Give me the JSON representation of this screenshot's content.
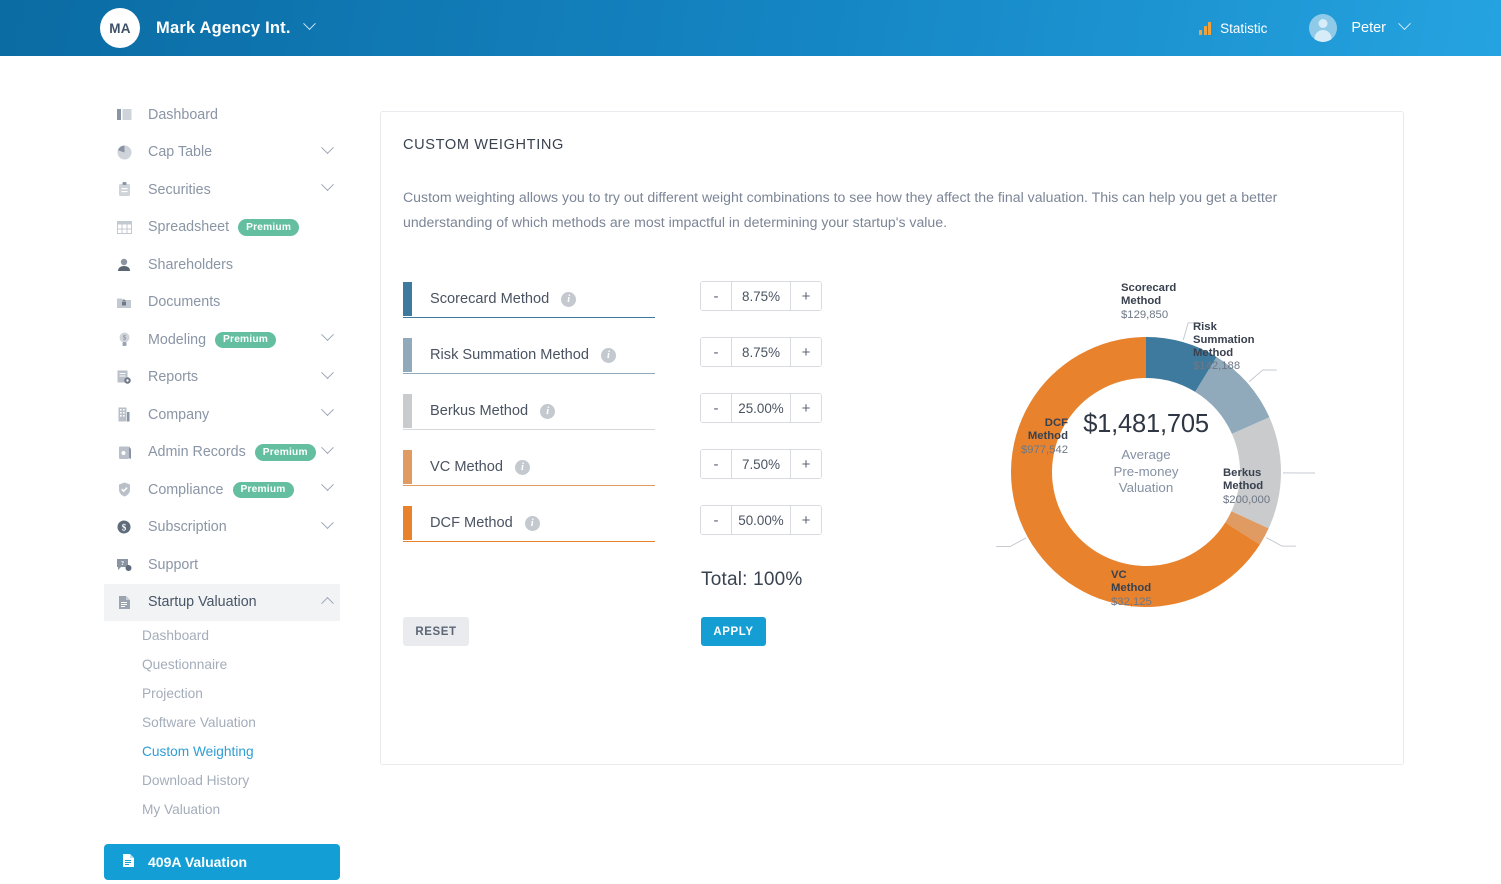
{
  "header": {
    "avatar_initials": "MA",
    "company": "Mark Agency Int.",
    "statistic_label": "Statistic",
    "user_name": "Peter",
    "icons": {
      "statistic": "bar-chart-icon",
      "company_chevron": "chevron-down-icon",
      "user_chevron": "chevron-down-icon"
    }
  },
  "sidebar": {
    "items": [
      {
        "label": "Dashboard",
        "icon": "dashboard-icon",
        "premium": null,
        "expandable": false
      },
      {
        "label": "Cap Table",
        "icon": "pie-chart-icon",
        "premium": null,
        "expandable": true
      },
      {
        "label": "Securities",
        "icon": "clipboard-icon",
        "premium": null,
        "expandable": true
      },
      {
        "label": "Spreadsheet",
        "icon": "table-icon",
        "premium": "Premium",
        "expandable": false
      },
      {
        "label": "Shareholders",
        "icon": "person-icon",
        "premium": null,
        "expandable": false
      },
      {
        "label": "Documents",
        "icon": "folder-lock-icon",
        "premium": null,
        "expandable": false
      },
      {
        "label": "Modeling",
        "icon": "lightbulb-icon",
        "premium": "Premium",
        "expandable": true
      },
      {
        "label": "Reports",
        "icon": "report-gear-icon",
        "premium": null,
        "expandable": true
      },
      {
        "label": "Company",
        "icon": "building-icon",
        "premium": null,
        "expandable": true
      },
      {
        "label": "Admin Records",
        "icon": "archive-icon",
        "premium": "Premium",
        "expandable": true
      },
      {
        "label": "Compliance",
        "icon": "shield-check-icon",
        "premium": "Premium",
        "expandable": true
      },
      {
        "label": "Subscription",
        "icon": "dollar-coin-icon",
        "premium": null,
        "expandable": true
      },
      {
        "label": "Support",
        "icon": "help-chat-icon",
        "premium": null,
        "expandable": false
      }
    ],
    "active_group": {
      "label": "Startup Valuation",
      "icon": "document-icon",
      "expandable": true,
      "expanded": true
    },
    "sub_items": [
      {
        "label": "Dashboard",
        "current": false
      },
      {
        "label": "Questionnaire",
        "current": false
      },
      {
        "label": "Projection",
        "current": false
      },
      {
        "label": "Software Valuation",
        "current": false
      },
      {
        "label": "Custom Weighting",
        "current": true
      },
      {
        "label": "Download History",
        "current": false
      },
      {
        "label": "My Valuation",
        "current": false
      }
    ],
    "cta": {
      "label": "409A Valuation",
      "icon": "document-icon"
    }
  },
  "main": {
    "title": "CUSTOM WEIGHTING",
    "description": "Custom weighting allows you to try out different weight combinations to see how they affect the final valuation. This can help you get a better understanding of which methods are most impactful in determining your startup's value.",
    "methods": [
      {
        "name": "Scorecard Method",
        "weight": "8.75%",
        "color": "#3e7a9e"
      },
      {
        "name": "Risk Summation Method",
        "weight": "8.75%",
        "color": "#90aabc"
      },
      {
        "name": "Berkus Method",
        "weight": "25.00%",
        "color": "#c9cbcc"
      },
      {
        "name": "VC Method",
        "weight": "7.50%",
        "color": "#e09b63"
      },
      {
        "name": "DCF Method",
        "weight": "50.00%",
        "color": "#e8822c"
      }
    ],
    "stepper": {
      "minus": "-",
      "plus": "+"
    },
    "total_label": "Total: 100%",
    "reset_label": "RESET",
    "apply_label": "APPLY"
  },
  "chart_data": {
    "type": "pie",
    "title": "",
    "center_value": "$1,481,705",
    "center_subtitle": "Average\nPre-money\nValuation",
    "center_subtitle_lines": [
      "Average",
      "Pre-money",
      "Valuation"
    ],
    "legend_position": "callout-labels",
    "categories": [
      "Scorecard Method",
      "Risk Summation Method",
      "Berkus Method",
      "VC Method",
      "DCF Method"
    ],
    "values": [
      129850,
      142188,
      200000,
      32125,
      977542
    ],
    "value_labels": [
      "$129,850",
      "$142,188",
      "$200,000",
      "$32,125",
      "$977,542"
    ],
    "percentages": [
      8.76,
      9.6,
      13.5,
      2.17,
      65.97
    ],
    "colors": [
      "#3e7a9e",
      "#90aabc",
      "#c9cbcc",
      "#e09b63",
      "#e8822c"
    ],
    "labels": [
      {
        "name_lines": [
          "Scorecard",
          "Method"
        ],
        "amount": "$129,850"
      },
      {
        "name_lines": [
          "Risk",
          "Summation",
          "Method"
        ],
        "amount": "$142,188"
      },
      {
        "name_lines": [
          "Berkus",
          "Method"
        ],
        "amount": "$200,000"
      },
      {
        "name_lines": [
          "VC",
          "Method"
        ],
        "amount": "$32,125"
      },
      {
        "name_lines": [
          "DCF",
          "Method"
        ],
        "amount": "$977,542"
      }
    ]
  }
}
